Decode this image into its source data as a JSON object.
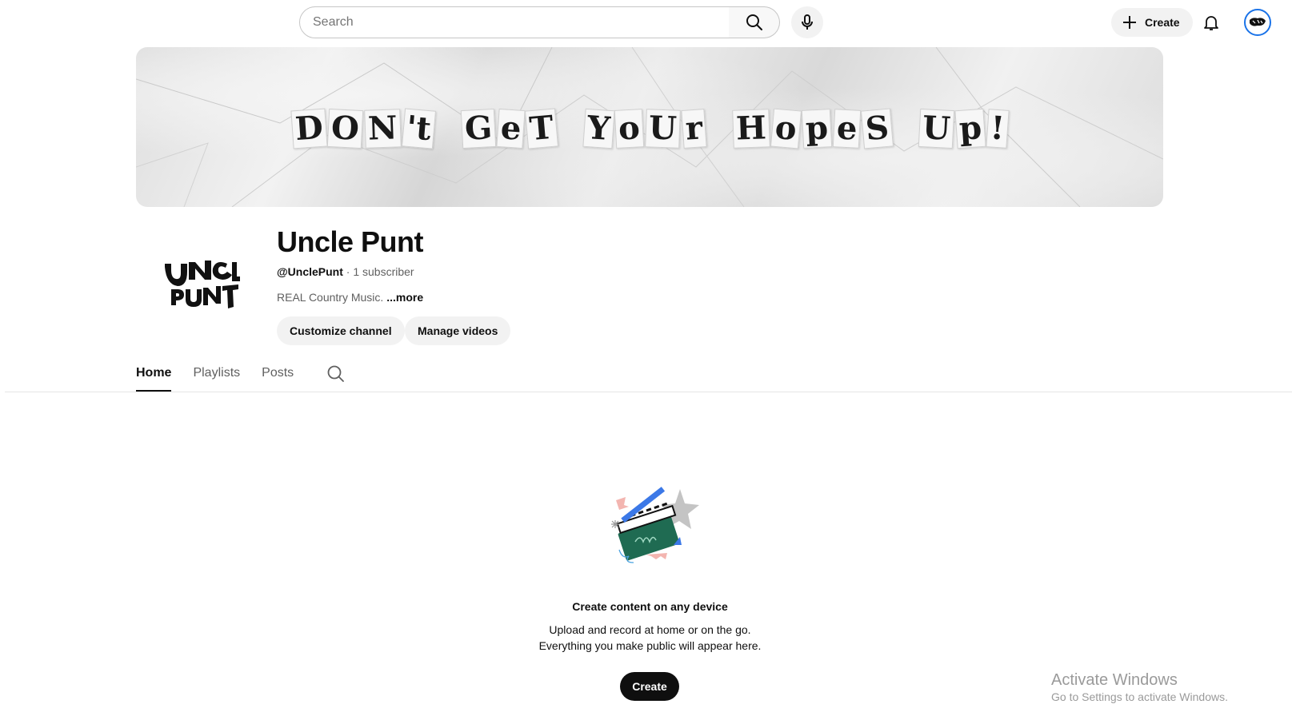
{
  "topbar": {
    "search_placeholder": "Search",
    "create_label": "Create"
  },
  "banner": {
    "words": [
      [
        "D",
        "O",
        "N",
        "'t"
      ],
      [
        "G",
        "e",
        "T"
      ],
      [
        "Y",
        "o",
        "U",
        "r"
      ],
      [
        "H",
        "o",
        "p",
        "e",
        "S"
      ],
      [
        "U",
        "p",
        "!"
      ]
    ]
  },
  "channel": {
    "name": "Uncle Punt",
    "handle": "@UnclePunt",
    "separator": " · ",
    "subscribers": "1 subscriber",
    "description": "REAL Country Music.",
    "more_label": " ...more",
    "customize_label": "Customize channel",
    "manage_label": "Manage videos"
  },
  "tabs": [
    {
      "label": "Home",
      "active": true
    },
    {
      "label": "Playlists",
      "active": false
    },
    {
      "label": "Posts",
      "active": false
    }
  ],
  "empty_state": {
    "title": "Create content on any device",
    "line1": "Upload and record at home or on the go.",
    "line2": "Everything you make public will appear here.",
    "button_label": "Create"
  },
  "watermark": {
    "title": "Activate Windows",
    "subtitle": "Go to Settings to activate Windows."
  },
  "colors": {
    "accent": "#1a73e8",
    "text": "#0f0f0f",
    "secondary": "#606060"
  }
}
